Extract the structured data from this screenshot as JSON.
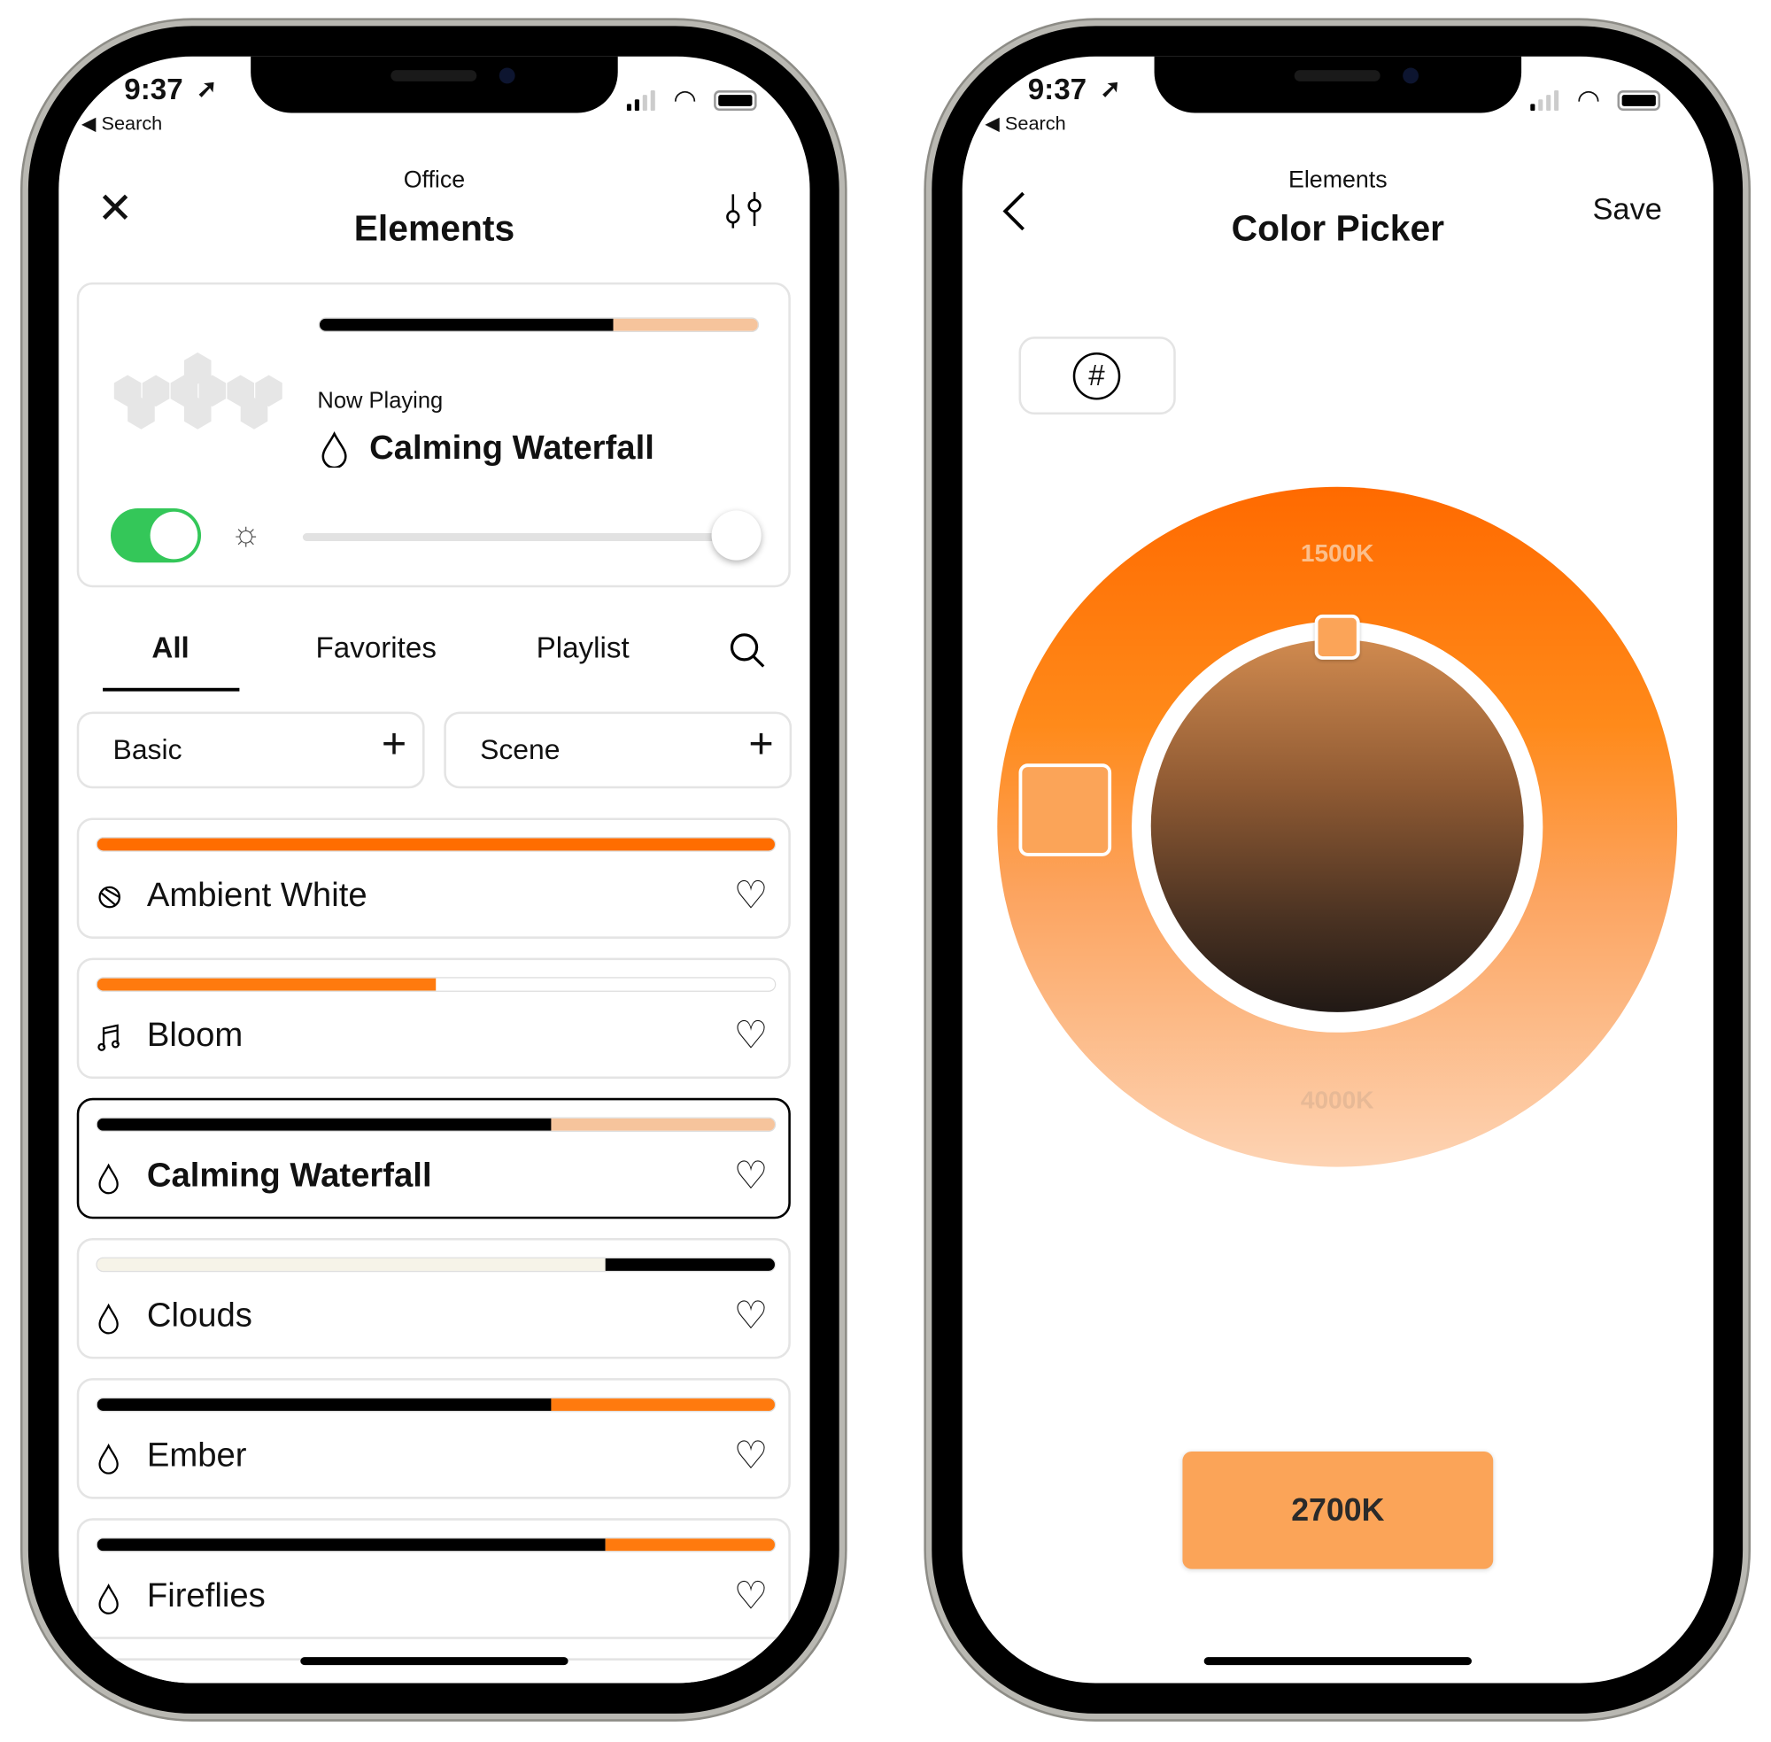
{
  "status_bar": {
    "time": "9:37",
    "back_label": "◀ Search"
  },
  "left_screen": {
    "header": {
      "subtitle": "Office",
      "title": "Elements"
    },
    "now_playing": {
      "label": "Now Playing",
      "title": "Calming Waterfall",
      "icon": "drop-icon",
      "palette": [
        {
          "color": "#000000",
          "fraction": 0.67
        },
        {
          "color": "#f6c49c",
          "fraction": 0.33
        }
      ],
      "power_on": true,
      "brightness": 1.0
    },
    "tabs": [
      {
        "label": "All",
        "active": true
      },
      {
        "label": "Favorites"
      },
      {
        "label": "Playlist"
      }
    ],
    "add_buttons": [
      {
        "label": "Basic"
      },
      {
        "label": "Scene"
      }
    ],
    "scenes": [
      {
        "name": "Ambient White",
        "icon": "ambient-icon",
        "selected": false,
        "palette": [
          {
            "color": "#ff6d00",
            "fraction": 1.0
          }
        ]
      },
      {
        "name": "Bloom",
        "icon": "music-note-icon",
        "selected": false,
        "palette": [
          {
            "color": "#ff7a0e",
            "fraction": 0.5
          },
          {
            "color": "#ffffff",
            "fraction": 0.5
          }
        ]
      },
      {
        "name": "Calming Waterfall",
        "icon": "drop-icon",
        "selected": true,
        "palette": [
          {
            "color": "#000000",
            "fraction": 0.67
          },
          {
            "color": "#f6c49c",
            "fraction": 0.33
          }
        ]
      },
      {
        "name": "Clouds",
        "icon": "drop-icon",
        "selected": false,
        "palette": [
          {
            "color": "#f6f3e8",
            "fraction": 0.75
          },
          {
            "color": "#000000",
            "fraction": 0.25
          }
        ]
      },
      {
        "name": "Ember",
        "icon": "drop-icon",
        "selected": false,
        "palette": [
          {
            "color": "#000000",
            "fraction": 0.67
          },
          {
            "color": "#ff7a0e",
            "fraction": 0.33
          }
        ]
      },
      {
        "name": "Fireflies",
        "icon": "drop-icon",
        "selected": false,
        "palette": [
          {
            "color": "#000000",
            "fraction": 0.75
          },
          {
            "color": "#ff7a0e",
            "fraction": 0.25
          }
        ]
      }
    ]
  },
  "right_screen": {
    "header": {
      "subtitle": "Elements",
      "title": "Color Picker",
      "save_label": "Save"
    },
    "wheel": {
      "top_label": "1500K",
      "bottom_label": "4000K"
    },
    "selected_color": "#fba458",
    "value_label": "2700K"
  },
  "colors": {
    "accent": "#ff6d00",
    "toggle_green": "#34c759"
  }
}
